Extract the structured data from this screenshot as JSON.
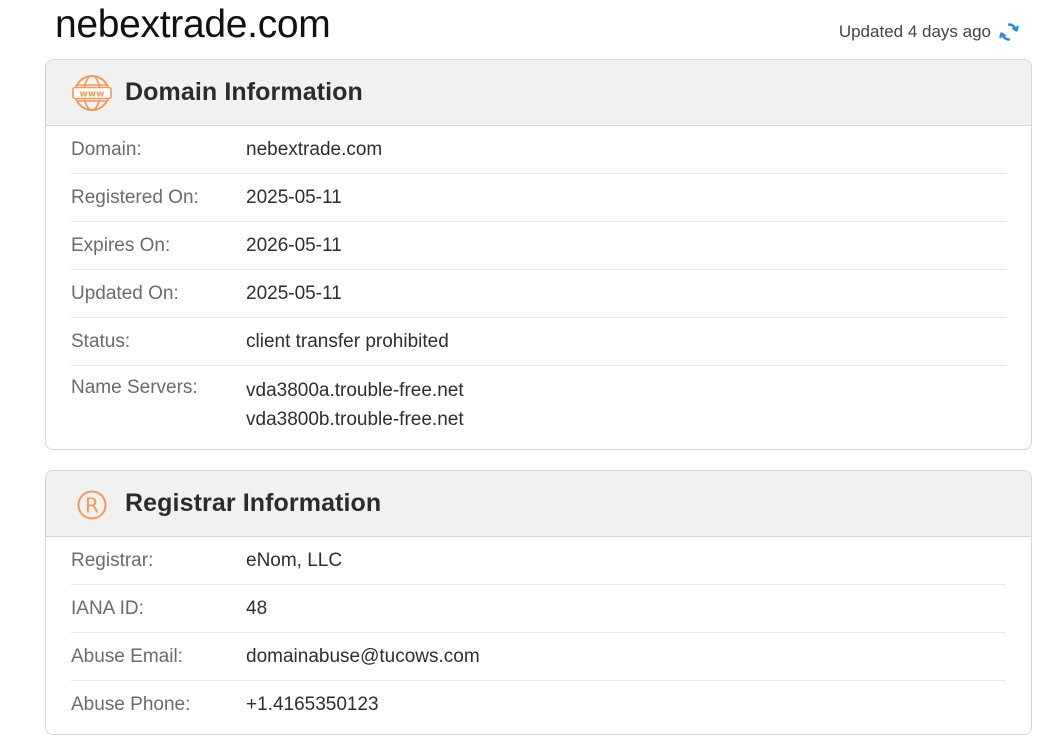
{
  "page": {
    "domain_title": "nebextrade.com",
    "updated_text": "Updated 4 days ago",
    "accent_color": "#2a8bd6",
    "icon_color": "#f19a5b"
  },
  "domain_info": {
    "title": "Domain Information",
    "icon": "www-globe-icon",
    "rows": [
      {
        "label": "Domain:",
        "value": "nebextrade.com"
      },
      {
        "label": "Registered On:",
        "value": "2025-05-11"
      },
      {
        "label": "Expires On:",
        "value": "2026-05-11"
      },
      {
        "label": "Updated On:",
        "value": "2025-05-11"
      },
      {
        "label": "Status:",
        "value": "client transfer prohibited"
      }
    ],
    "name_servers": {
      "label": "Name Servers:",
      "values": [
        "vda3800a.trouble-free.net",
        "vda3800b.trouble-free.net"
      ]
    }
  },
  "registrar_info": {
    "title": "Registrar Information",
    "icon": "registered-trademark-icon",
    "rows": [
      {
        "label": "Registrar:",
        "value": "eNom, LLC"
      },
      {
        "label": "IANA ID:",
        "value": "48"
      },
      {
        "label": "Abuse Email:",
        "value": "domainabuse@tucows.com"
      },
      {
        "label": "Abuse Phone:",
        "value": "+1.4165350123"
      }
    ]
  }
}
